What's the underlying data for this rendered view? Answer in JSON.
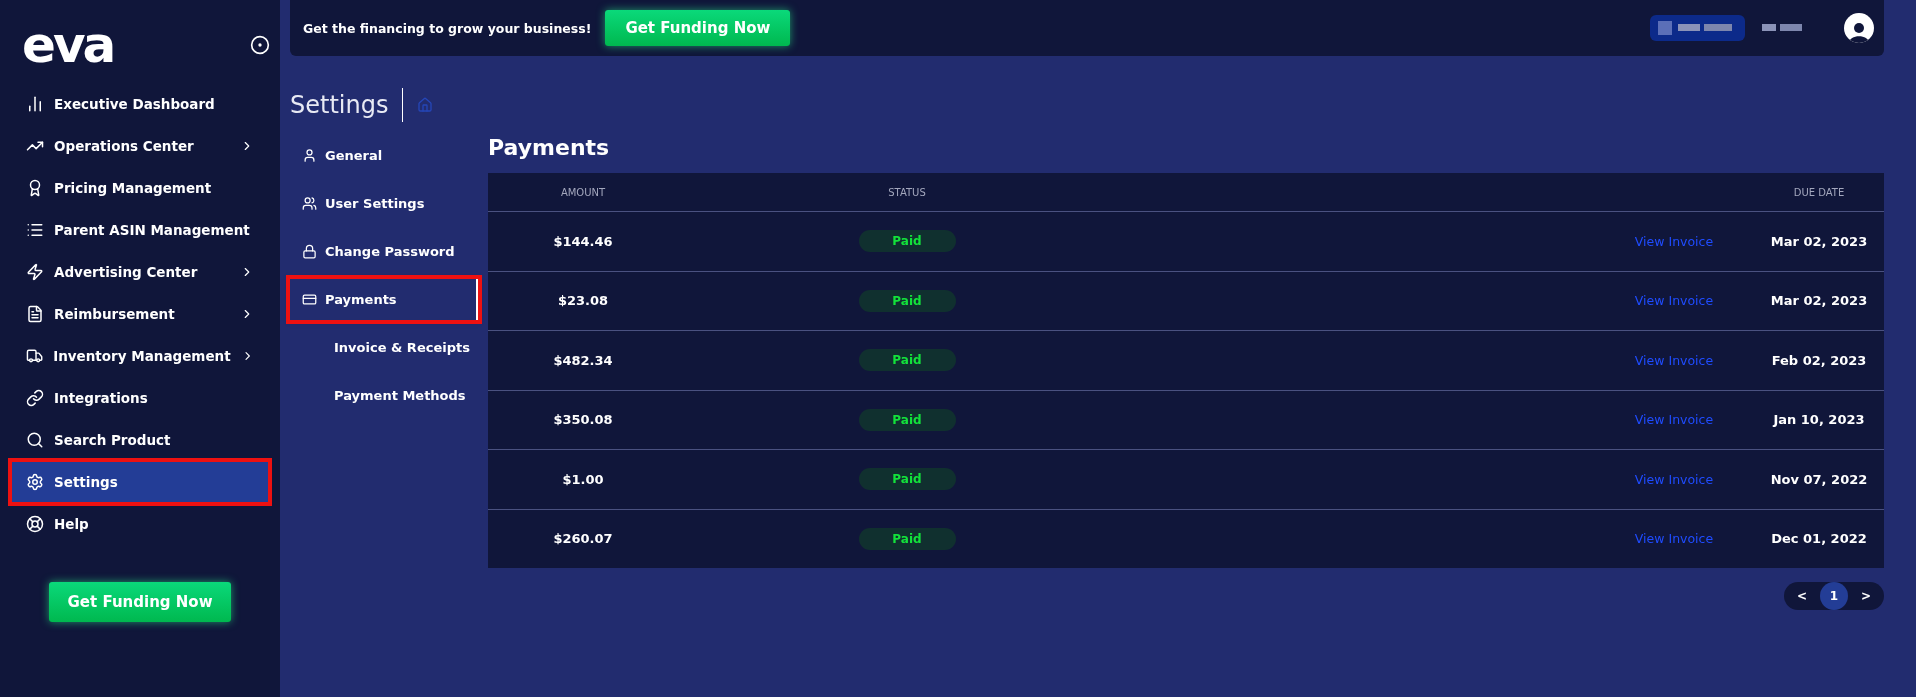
{
  "sidebar": {
    "logo": "eva",
    "items": [
      {
        "label": "Executive Dashboard",
        "has_submenu": false,
        "selected": false,
        "highlighted": false
      },
      {
        "label": "Operations Center",
        "has_submenu": true,
        "selected": false,
        "highlighted": false
      },
      {
        "label": "Pricing Management",
        "has_submenu": false,
        "selected": false,
        "highlighted": false
      },
      {
        "label": "Parent ASIN Management",
        "has_submenu": false,
        "selected": false,
        "highlighted": false
      },
      {
        "label": "Advertising Center",
        "has_submenu": true,
        "selected": false,
        "highlighted": false
      },
      {
        "label": "Reimbursement",
        "has_submenu": true,
        "selected": false,
        "highlighted": false
      },
      {
        "label": "Inventory Management",
        "has_submenu": true,
        "selected": false,
        "highlighted": false
      },
      {
        "label": "Integrations",
        "has_submenu": false,
        "selected": false,
        "highlighted": false
      },
      {
        "label": "Search Product",
        "has_submenu": false,
        "selected": false,
        "highlighted": false
      },
      {
        "label": "Settings",
        "has_submenu": false,
        "selected": true,
        "highlighted": true
      },
      {
        "label": "Help",
        "has_submenu": false,
        "selected": false,
        "highlighted": false
      }
    ],
    "cta": "Get Funding Now"
  },
  "top_bar": {
    "promo": "Get the financing to grow your business!",
    "cta": "Get Funding Now"
  },
  "page_title": "Settings",
  "settings_menu": [
    {
      "label": "General",
      "sub": false,
      "selected": false,
      "highlighted": false
    },
    {
      "label": "User Settings",
      "sub": false,
      "selected": false,
      "highlighted": false
    },
    {
      "label": "Change Password",
      "sub": false,
      "selected": false,
      "highlighted": false
    },
    {
      "label": "Payments",
      "sub": false,
      "selected": true,
      "highlighted": true
    },
    {
      "label": "Invoice & Receipts",
      "sub": true,
      "selected": false,
      "highlighted": false
    },
    {
      "label": "Payment Methods",
      "sub": true,
      "selected": false,
      "highlighted": false
    }
  ],
  "section_title": "Payments",
  "table": {
    "columns": [
      "AMOUNT",
      "STATUS",
      "DUE DATE"
    ],
    "rows": [
      {
        "amount": "$144.46",
        "status": "Paid",
        "link": "View Invoice",
        "due_date": "Mar 02, 2023"
      },
      {
        "amount": "$23.08",
        "status": "Paid",
        "link": "View Invoice",
        "due_date": "Mar 02, 2023"
      },
      {
        "amount": "$482.34",
        "status": "Paid",
        "link": "View Invoice",
        "due_date": "Feb 02, 2023"
      },
      {
        "amount": "$350.08",
        "status": "Paid",
        "link": "View Invoice",
        "due_date": "Jan 10, 2023"
      },
      {
        "amount": "$1.00",
        "status": "Paid",
        "link": "View Invoice",
        "due_date": "Nov 07, 2022"
      },
      {
        "amount": "$260.07",
        "status": "Paid",
        "link": "View Invoice",
        "due_date": "Dec 01, 2022"
      }
    ]
  },
  "pagination": {
    "prev": "<",
    "pages": [
      {
        "label": "1",
        "selected": true
      }
    ],
    "next": ">"
  }
}
